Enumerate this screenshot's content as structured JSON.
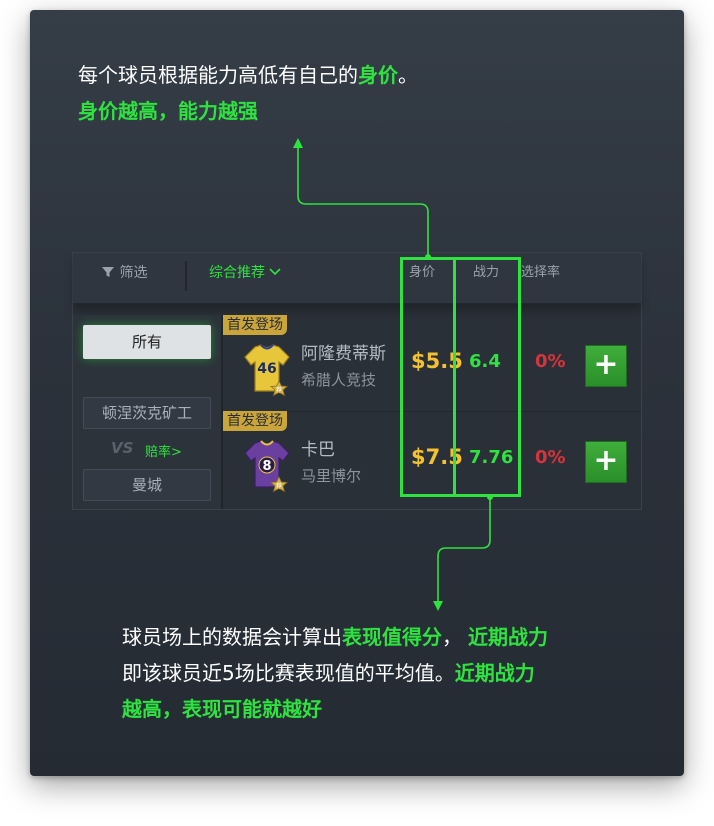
{
  "intro": {
    "line1_prefix": "每个球员根据能力高低有自己的",
    "line1_highlight": "身价",
    "line1_suffix": "。",
    "line2": "身价越高，能力越强"
  },
  "header": {
    "filter_label": "筛选",
    "sort_label": "综合推荐",
    "col_price": "身价",
    "col_power": "战力",
    "col_pick_rate": "选择率"
  },
  "sidebar": {
    "all_label": "所有",
    "team_home": "顿涅茨克矿工",
    "vs_label": "VS",
    "odds_label": "赔率>",
    "team_away": "曼城"
  },
  "players": [
    {
      "tag": "首发登场",
      "number": "46",
      "name": "阿隆费蒂斯",
      "club": "希腊人竞技",
      "price": "$5.5",
      "power": "6.4",
      "pick_rate": "0%",
      "jersey_color": "#e8c63a",
      "badge": "荐"
    },
    {
      "tag": "首发登场",
      "number": "8",
      "name": "卡巴",
      "club": "马里博尔",
      "price": "$7.5",
      "power": "7.76",
      "pick_rate": "0%",
      "jersey_color": "#6a3fa0",
      "badge": "荐"
    }
  ],
  "outro": {
    "line1_prefix": "球员场上的数据会计算出",
    "line1_highlight1": "表现值得分",
    "line1_mid": "，",
    "line1_highlight2": "近期战力",
    "line2_prefix": "即该球员近5场比赛表现值的平均值。",
    "line2_highlight": "近期战力",
    "line3": "越高，表现可能就越好"
  },
  "colors": {
    "accent_green": "#2ee23f",
    "price_gold": "#f4c130",
    "rate_red": "#d8323b"
  }
}
